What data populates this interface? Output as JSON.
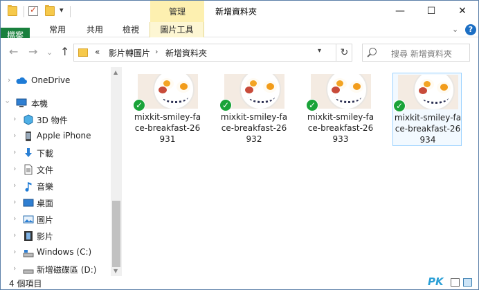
{
  "titlebar": {
    "context_tab": "管理",
    "title": "新增資料夾",
    "minimize_glyph": "—",
    "maximize_glyph": "☐",
    "close_glyph": "✕"
  },
  "ribbon": {
    "tabs": [
      "檔案",
      "常用",
      "共用",
      "檢視",
      "圖片工具"
    ],
    "collapse_glyph": "⌄",
    "help_glyph": "?",
    "accent_file": "#19803d",
    "accent_context": "#fdf0b0"
  },
  "address": {
    "back_glyph": "←",
    "forward_glyph": "→",
    "recent_glyph": "⌄",
    "up_glyph": "↑",
    "overflow": "«",
    "crumbs": [
      "影片轉圖片",
      "新增資料夾"
    ],
    "separator": "›",
    "refresh_glyph": "↻"
  },
  "search": {
    "placeholder": "搜尋 新增資料夾"
  },
  "nav": {
    "items": [
      {
        "label": "OneDrive",
        "icon": "cloud-icon"
      },
      {
        "label": "本機",
        "icon": "computer-icon"
      },
      {
        "label": "3D 物件",
        "icon": "cube-icon"
      },
      {
        "label": "Apple iPhone",
        "icon": "phone-icon"
      },
      {
        "label": "下載",
        "icon": "download-icon"
      },
      {
        "label": "文件",
        "icon": "document-icon"
      },
      {
        "label": "音樂",
        "icon": "music-icon"
      },
      {
        "label": "桌面",
        "icon": "desktop-icon"
      },
      {
        "label": "圖片",
        "icon": "pictures-icon"
      },
      {
        "label": "影片",
        "icon": "videos-icon"
      },
      {
        "label": "Windows (C:)",
        "icon": "drive-icon"
      },
      {
        "label": "新增磁碟區 (D:)",
        "icon": "drive-icon"
      }
    ]
  },
  "files": [
    {
      "name": "mixkit-smiley-face-breakfast-26931",
      "selected": false
    },
    {
      "name": "mixkit-smiley-face-breakfast-26932",
      "selected": false
    },
    {
      "name": "mixkit-smiley-face-breakfast-26933",
      "selected": false
    },
    {
      "name": "mixkit-smiley-face-breakfast-26934",
      "selected": true
    }
  ],
  "status": {
    "count": "4 個項目",
    "watermark": "PK"
  }
}
